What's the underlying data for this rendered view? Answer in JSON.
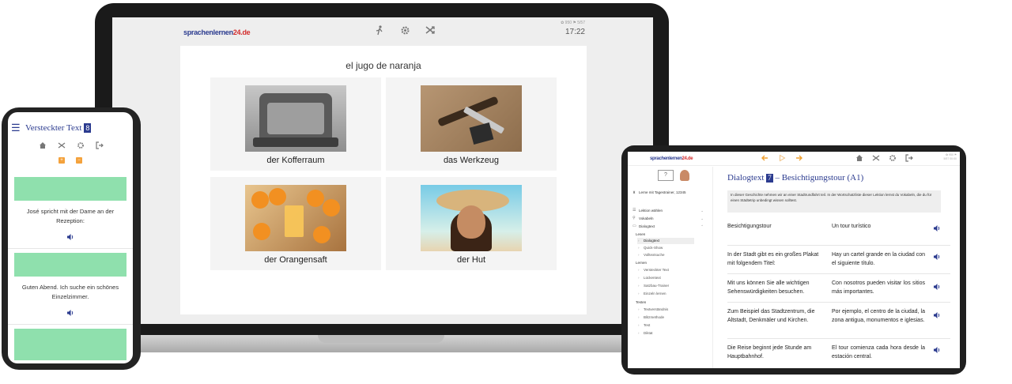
{
  "laptop": {
    "logo_main": "sprachenlernen",
    "logo_suffix": "24.de",
    "status_tiny": "✿ 950   ⚑ 5/57",
    "time": "17:22",
    "question": "el jugo de naranja",
    "options": [
      {
        "caption": "der Kofferraum"
      },
      {
        "caption": "das Werkzeug"
      },
      {
        "caption": "der Orangensaft"
      },
      {
        "caption": "der Hut"
      }
    ]
  },
  "phone": {
    "title": "Versteckter Text",
    "badge": "8",
    "items": [
      {
        "text": "José spricht mit der Dame an der Rezeption:"
      },
      {
        "text": "Guten Abend. Ich suche ein schönes Einzelzimmer."
      }
    ]
  },
  "tablet": {
    "logo_main": "sprachenlernen",
    "logo_suffix": "24.de",
    "status_tiny": "✿ 950 ⚑ 5/57 00:00",
    "sidebar": {
      "trainer": "Lerne mit Tagestrainer, 12345",
      "sections": [
        {
          "label": "Lektion wählen"
        },
        {
          "label": "Vokabeln"
        },
        {
          "label": "Dialogtext"
        }
      ],
      "group_lesen": "Lesen",
      "lesen_items": [
        "Dialogtext",
        "Quick-Show",
        "Volltextsuche"
      ],
      "group_lernen": "Lernen",
      "lernen_items": [
        "Versteckter Text",
        "Lückentext",
        "Satzbau-Trainer",
        "Einzeln lernen"
      ],
      "group_testen": "Testen",
      "testen_items": [
        "Textverständnis",
        "Blitzmethode",
        "Test",
        "Diktat"
      ]
    },
    "main": {
      "title_pre": "Dialogtext",
      "title_badge": "7",
      "title_post": " – Besichtigungstour (A1)",
      "intro": "In dieser Geschichte nehmen wir an einer Stadtrundfahrt teil. In der Wortschatzliste dieser Lektion lernst du Vokabeln, die du für einen Städtetrip unbedingt wissen solltest.",
      "rows": [
        {
          "de": "Besichtigungstour",
          "es": "Un tour turístico"
        },
        {
          "de": "In der Stadt gibt es ein großes Plakat mit folgendem Titel:",
          "es": "Hay un cartel grande en la ciudad con el siguiente título."
        },
        {
          "de": "Mit uns können Sie alle wichtigen Sehenswürdigkeiten besuchen.",
          "es": "Con nosotros pueden visitar los sitios más importantes."
        },
        {
          "de": "Zum Beispiel das Stadtzentrum, die Altstadt, Denkmäler und Kirchen.",
          "es": "Por ejemplo, el centro de la ciudad, la zona antigua, monumentos e iglesias."
        },
        {
          "de": "Die Reise beginnt jede Stunde am Hauptbahnhof.",
          "es": "El tour comienza cada hora desde la estación central."
        }
      ]
    }
  }
}
